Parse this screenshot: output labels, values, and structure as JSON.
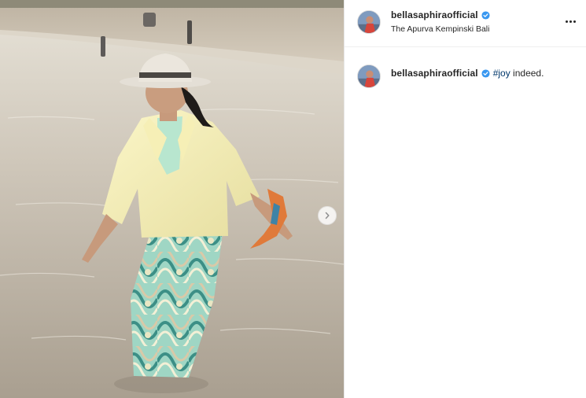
{
  "post": {
    "author": {
      "username": "bellasaphiraofficial",
      "verified": true,
      "location": "The Apurva Kempinski Bali",
      "avatar_icon": "profile-avatar"
    },
    "caption": {
      "username": "bellasaphiraofficial",
      "hashtag": "#joy",
      "text": " indeed."
    },
    "media": {
      "description_icon": "photo-woman-walking-in-sea",
      "carousel_next_icon": "chevron-right-icon"
    },
    "menu_icon": "more-options-icon"
  },
  "colors": {
    "link": "#00376b",
    "verified_badge": "#3897f0",
    "text": "#262626",
    "divider": "#efefef"
  }
}
